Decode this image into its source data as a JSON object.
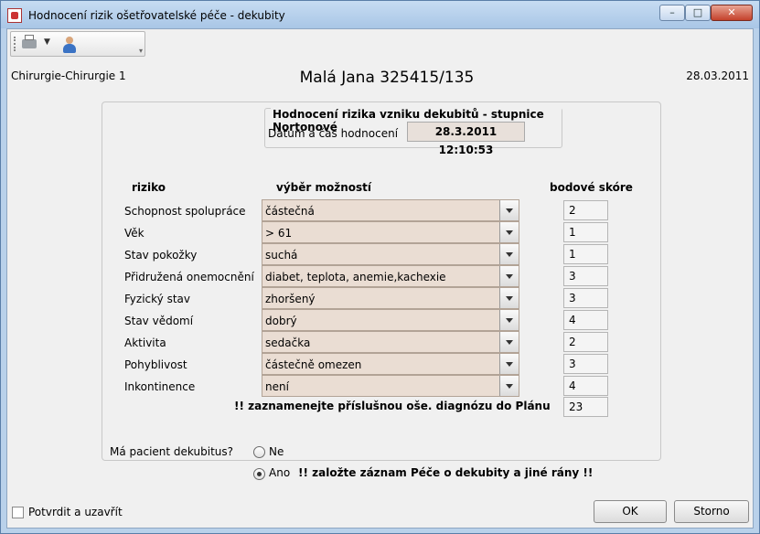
{
  "window": {
    "title": "Hodnocení rizik ošetřovatelské péče - dekubity"
  },
  "header": {
    "department": "Chirurgie-Chirurgie 1",
    "patient": "Malá Jana 325415/135",
    "date": "28.03.2011"
  },
  "panel": {
    "group_title": "Hodnocení rizika vzniku dekubitů - stupnice Nortonové",
    "datetime_label": "Datum a čas hodnocení",
    "datetime_value": "28.3.2011 12:10:53",
    "col_risk": "riziko",
    "col_options": "výběr možností",
    "col_score": "bodové skóre",
    "rows": [
      {
        "label": "Schopnost spolupráce",
        "value": "částečná",
        "score": "2"
      },
      {
        "label": "Věk",
        "value": "> 61",
        "score": "1"
      },
      {
        "label": "Stav pokožky",
        "value": "suchá",
        "score": "1"
      },
      {
        "label": "Přidružená onemocnění",
        "value": "diabet, teplota, anemie,kachexie",
        "score": "3"
      },
      {
        "label": "Fyzický stav",
        "value": "zhoršený",
        "score": "3"
      },
      {
        "label": "Stav vědomí",
        "value": "dobrý",
        "score": "4"
      },
      {
        "label": "Aktivita",
        "value": "sedačka",
        "score": "2"
      },
      {
        "label": "Pohyblivost",
        "value": "částečně omezen",
        "score": "3"
      },
      {
        "label": "Inkontinence",
        "value": "není",
        "score": "4"
      }
    ],
    "note": "!! zaznamenejte příslušnou oše. diagnózu do Plánu",
    "total_score": "23",
    "decubitus_question": "Má pacient dekubitus?",
    "option_no": "Ne",
    "option_yes": "Ano",
    "selected_option": "Ano",
    "yes_note": "!! založte záznam Péče o dekubity a jiné rány !!"
  },
  "footer": {
    "confirm_close": "Potvrdit a uzavřít",
    "ok": "OK",
    "cancel": "Storno"
  }
}
